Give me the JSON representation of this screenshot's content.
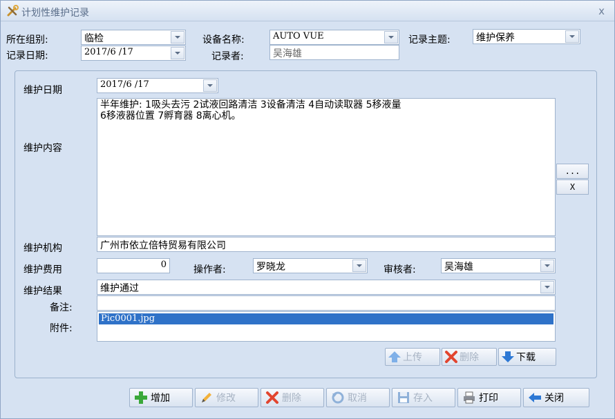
{
  "window": {
    "title": "计划性维护记录",
    "close_label": "x"
  },
  "header": {
    "group_label": "所在组别:",
    "group_value": "临检",
    "device_label": "设备名称:",
    "device_value": "AUTO VUE",
    "subject_label": "记录主题:",
    "subject_value": "维护保养",
    "date_label": "记录日期:",
    "date_value": "2017/6 /17",
    "recorder_label": "记录者:",
    "recorder_value": "吴海雄"
  },
  "form": {
    "maint_date_label": "维护日期",
    "maint_date_value": "2017/6 /17",
    "content_label": "维护内容",
    "content_value": "半年维护: 1吸头去污 2试液回路清洁 3设备清洁 4自动读取器 5移液量\n6移液器位置 7孵育器 8离心机。",
    "more_button": "...",
    "clear_button": "X",
    "org_label": "维护机构",
    "org_value": "广州市依立倍特贸易有限公司",
    "cost_label": "维护费用",
    "cost_value": "0",
    "operator_label": "操作者:",
    "operator_value": "罗晓龙",
    "reviewer_label": "审核者:",
    "reviewer_value": "吴海雄",
    "result_label": "维护结果",
    "result_value": "维护通过",
    "remark_label": "备注:",
    "remark_value": "",
    "attach_label": "附件:",
    "attachments": [
      "Pic0001.jpg"
    ]
  },
  "attach_buttons": {
    "upload": "上传",
    "delete": "删除",
    "download": "下载"
  },
  "toolbar": {
    "add": "增加",
    "edit": "修改",
    "delete": "删除",
    "cancel": "取消",
    "save": "存入",
    "print": "打印",
    "close": "关闭"
  },
  "colors": {
    "accent": "#2f72c8",
    "background": "#d6e2f2",
    "disabled_text": "#a7b3c3"
  }
}
